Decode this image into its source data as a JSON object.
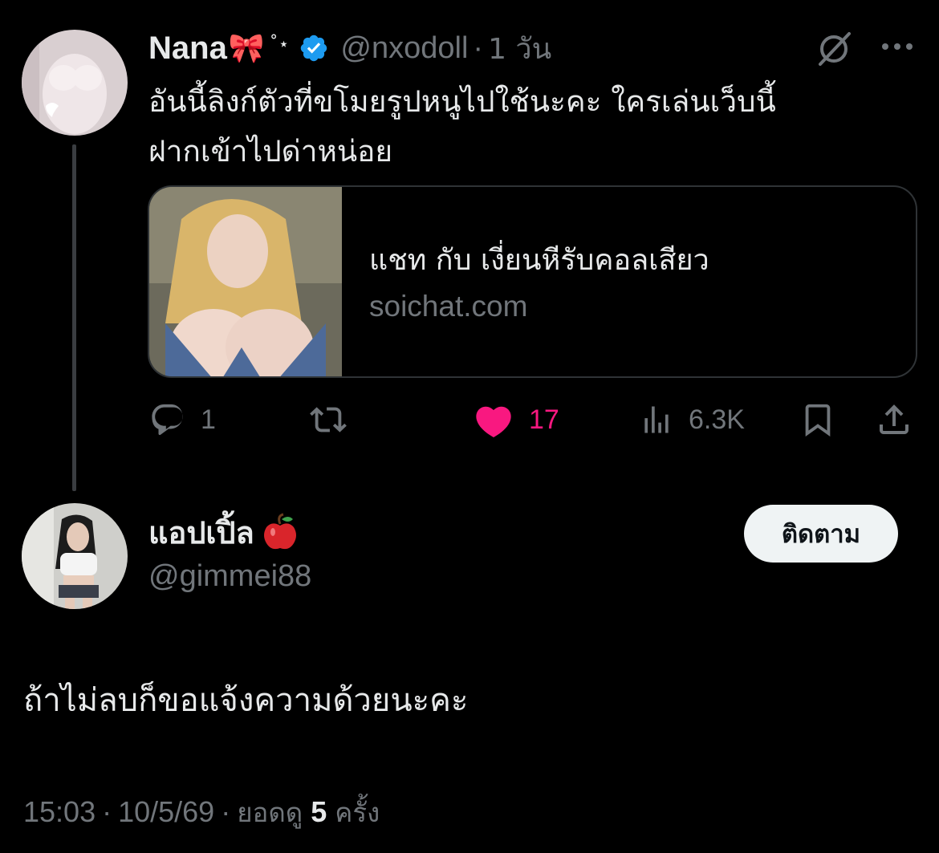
{
  "tweet": {
    "author_name": "Nana",
    "author_emoji": "🎀",
    "author_sparkle": "˚⋆",
    "handle": "@nxodoll",
    "time_separator": "·",
    "time_ago": "1 วัน",
    "text": "อันนี้ลิงก์ตัวที่ขโมยรูปหนูไปใช้นะคะ ใครเล่นเว็บนี้\nฝากเข้าไปด่าหน่อย",
    "link_card": {
      "title": "แชท กับ เงี่ยนหีรับคอลเสียว",
      "domain": "soichat.com"
    },
    "actions": {
      "reply_count": "1",
      "like_count": "17",
      "views_count": "6.3K"
    }
  },
  "reply": {
    "author_name": "แอปเปิ้ล",
    "handle": "@gimmei88",
    "follow_label": "ติดตาม",
    "text": "ถ้าไม่ลบก็ขอแจ้งความด้วยนะคะ",
    "time": "15:03",
    "separator": "·",
    "date": "10/5/69",
    "views_prefix": "ยอดดู",
    "views_number": "5",
    "views_suffix": "ครั้ง"
  },
  "colors": {
    "background": "#000000",
    "text_primary": "#e7e9ea",
    "text_secondary": "#71767b",
    "like_active": "#f91880",
    "verified_blue": "#1d9bf0",
    "card_border": "#2f3336"
  },
  "icons": {
    "verified": "verified-badge-icon",
    "grok": "grok-icon",
    "more": "more-icon",
    "reply": "reply-icon",
    "retweet": "retweet-icon",
    "like": "heart-icon",
    "views": "views-icon",
    "bookmark": "bookmark-icon",
    "share": "share-icon"
  }
}
